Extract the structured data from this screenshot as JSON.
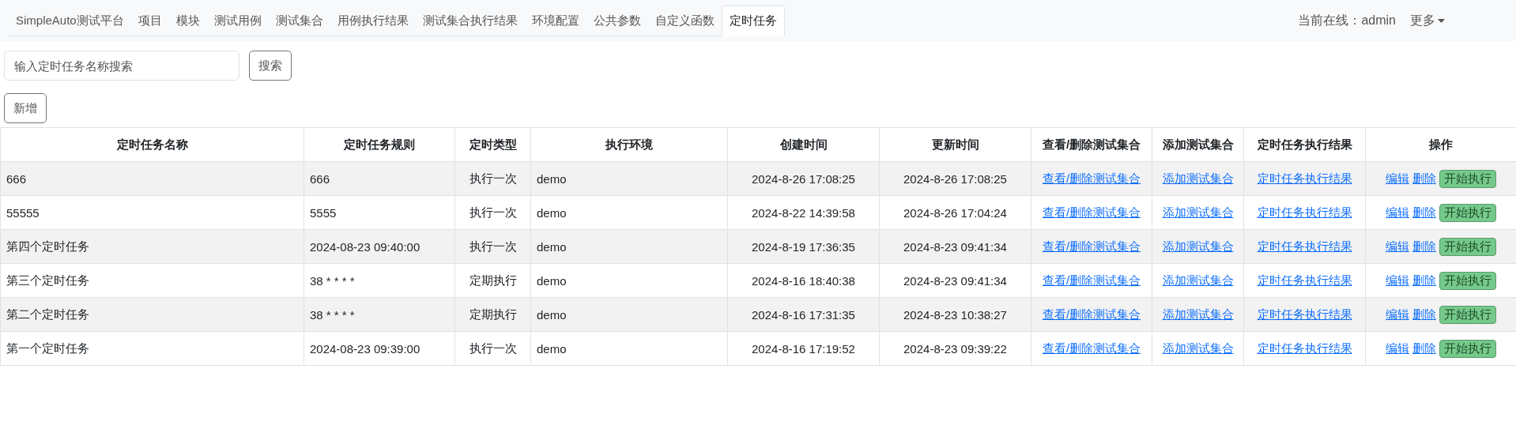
{
  "nav": {
    "brand": "SimpleAuto测试平台",
    "tabs": [
      {
        "label": "项目",
        "selected": false
      },
      {
        "label": "模块",
        "selected": false
      },
      {
        "label": "测试用例",
        "selected": false
      },
      {
        "label": "测试集合",
        "selected": false
      },
      {
        "label": "用例执行结果",
        "selected": false
      },
      {
        "label": "测试集合执行结果",
        "selected": false
      },
      {
        "label": "环境配置",
        "selected": false
      },
      {
        "label": "公共参数",
        "selected": false
      },
      {
        "label": "自定义函数",
        "selected": false
      },
      {
        "label": "定时任务",
        "selected": true
      }
    ],
    "online_user": "当前在线：admin",
    "more": "更多"
  },
  "search": {
    "placeholder": "输入定时任务名称搜索",
    "button": "搜索"
  },
  "add_button": "新增",
  "table": {
    "columns": [
      "定时任务名称",
      "定时任务规则",
      "定时类型",
      "执行环境",
      "创建时间",
      "更新时间",
      "查看/删除测试集合",
      "添加测试集合",
      "定时任务执行结果",
      "操作"
    ],
    "rows": [
      {
        "name": "666",
        "rule": "666",
        "type": "执行一次",
        "env": "demo",
        "created": "2024-8-26 17:08:25",
        "updated": "2024-8-26 17:08:25",
        "view_link": "查看/删除测试集合",
        "add_link": "添加测试集合",
        "result_link": "定时任务执行结果",
        "actions": [
          "编辑",
          "删除",
          "开始执行"
        ]
      },
      {
        "name": "55555",
        "rule": "5555",
        "type": "执行一次",
        "env": "demo",
        "created": "2024-8-22 14:39:58",
        "updated": "2024-8-26 17:04:24",
        "view_link": "查看/删除测试集合",
        "add_link": "添加测试集合",
        "result_link": "定时任务执行结果",
        "actions": [
          "编辑",
          "删除",
          "开始执行"
        ]
      },
      {
        "name": "第四个定时任务",
        "rule": "2024-08-23 09:40:00",
        "type": "执行一次",
        "env": "demo",
        "created": "2024-8-19 17:36:35",
        "updated": "2024-8-23 09:41:34",
        "view_link": "查看/删除测试集合",
        "add_link": "添加测试集合",
        "result_link": "定时任务执行结果",
        "actions": [
          "编辑",
          "删除",
          "开始执行"
        ]
      },
      {
        "name": "第三个定时任务",
        "rule": "38 * * * *",
        "type": "定期执行",
        "env": "demo",
        "created": "2024-8-16 18:40:38",
        "updated": "2024-8-23 09:41:34",
        "view_link": "查看/删除测试集合",
        "add_link": "添加测试集合",
        "result_link": "定时任务执行结果",
        "actions": [
          "编辑",
          "删除",
          "开始执行"
        ]
      },
      {
        "name": "第二个定时任务",
        "rule": "38 * * * *",
        "type": "定期执行",
        "env": "demo",
        "created": "2024-8-16 17:31:35",
        "updated": "2024-8-23 10:38:27",
        "view_link": "查看/删除测试集合",
        "add_link": "添加测试集合",
        "result_link": "定时任务执行结果",
        "actions": [
          "编辑",
          "删除",
          "开始执行"
        ]
      },
      {
        "name": "第一个定时任务",
        "rule": "2024-08-23 09:39:00",
        "type": "执行一次",
        "env": "demo",
        "created": "2024-8-16 17:19:52",
        "updated": "2024-8-23 09:39:22",
        "view_link": "查看/删除测试集合",
        "add_link": "添加测试集合",
        "result_link": "定时任务执行结果",
        "actions": [
          "编辑",
          "删除",
          "开始执行"
        ]
      }
    ]
  }
}
